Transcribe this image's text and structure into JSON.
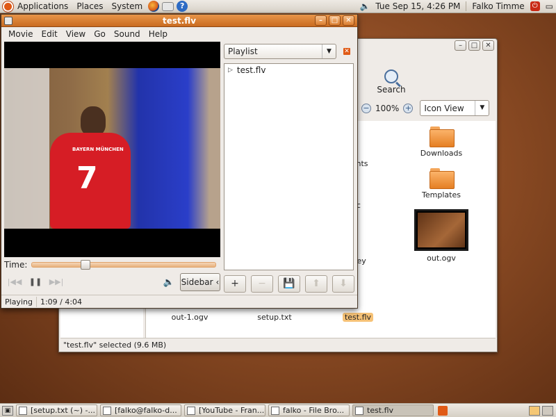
{
  "top_panel": {
    "menus": [
      "Applications",
      "Places",
      "System"
    ],
    "clock": "Tue Sep 15,  4:26 PM",
    "user": "Falko Timme"
  },
  "file_browser": {
    "toolbar": {
      "search_label": "Search"
    },
    "zoom": "100%",
    "view_mode": "Icon View",
    "items": [
      {
        "label": "ments"
      },
      {
        "label": "Downloads"
      },
      {
        "label": "olic"
      },
      {
        "label": "Templates"
      },
      {
        "label": "b.key"
      },
      {
        "label": "out.ogv"
      },
      {
        "label": "out-1.ogv"
      },
      {
        "label": "setup.txt"
      },
      {
        "label": "test.flv"
      }
    ],
    "status": "\"test.flv\" selected (9.6 MB)"
  },
  "movie_player": {
    "title": "test.flv",
    "menus": [
      "Movie",
      "Edit",
      "View",
      "Go",
      "Sound",
      "Help"
    ],
    "video": {
      "jersey_number": "7",
      "jersey_name": "BAYERN MÜNCHEN"
    },
    "time_label": "Time:",
    "position_fraction": 0.29,
    "sidebar_button": "Sidebar",
    "playlist": {
      "selector": "Playlist",
      "items": [
        "test.flv"
      ]
    },
    "status": {
      "state": "Playing",
      "time": "1:09 / 4:04"
    }
  },
  "taskbar": {
    "tasks": [
      "[setup.txt (~) -...",
      "[falko@falko-d...",
      "[YouTube - Fran...",
      "falko - File Bro...",
      "test.flv"
    ]
  }
}
